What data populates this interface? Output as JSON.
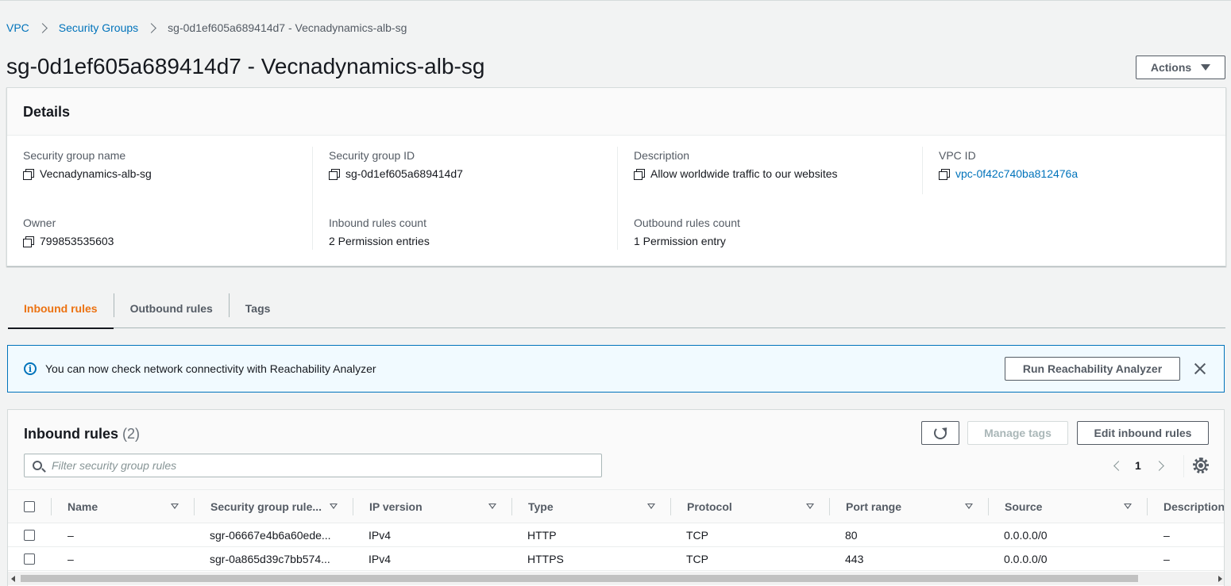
{
  "breadcrumb": {
    "items": [
      "VPC",
      "Security Groups",
      "sg-0d1ef605a689414d7 - Vecnadynamics-alb-sg"
    ]
  },
  "page": {
    "title": "sg-0d1ef605a689414d7 - Vecnadynamics-alb-sg",
    "actions_label": "Actions"
  },
  "details": {
    "heading": "Details",
    "fields": [
      {
        "key": "Security group name",
        "value": "Vecnadynamics-alb-sg"
      },
      {
        "key": "Security group ID",
        "value": "sg-0d1ef605a689414d7"
      },
      {
        "key": "Description",
        "value": "Allow worldwide traffic to our websites"
      },
      {
        "key": "VPC ID",
        "value": "vpc-0f42c740ba812476a"
      },
      {
        "key": "Owner",
        "value": "799853535603"
      },
      {
        "key": "Inbound rules count",
        "value": "2 Permission entries"
      },
      {
        "key": "Outbound rules count",
        "value": "1 Permission entry"
      }
    ]
  },
  "tabs": [
    {
      "label": "Inbound rules",
      "active": true
    },
    {
      "label": "Outbound rules",
      "active": false
    },
    {
      "label": "Tags",
      "active": false
    }
  ],
  "flash": {
    "message": "You can now check network connectivity with Reachability Analyzer",
    "button_label": "Run Reachability Analyzer"
  },
  "rules": {
    "title": "Inbound rules",
    "count": "(2)",
    "manage_tags_label": "Manage tags",
    "edit_label": "Edit inbound rules",
    "filter_placeholder": "Filter security group rules",
    "page": "1",
    "columns": [
      "Name",
      "Security group rule...",
      "IP version",
      "Type",
      "Protocol",
      "Port range",
      "Source",
      "Description"
    ],
    "rows": [
      {
        "name": "–",
        "rule_id": "sgr-06667e4b6a60ede...",
        "ip_version": "IPv4",
        "type": "HTTP",
        "protocol": "TCP",
        "port_range": "80",
        "source": "0.0.0.0/0",
        "description": "–"
      },
      {
        "name": "–",
        "rule_id": "sgr-0a865d39c7bb574...",
        "ip_version": "IPv4",
        "type": "HTTPS",
        "protocol": "TCP",
        "port_range": "443",
        "source": "0.0.0.0/0",
        "description": "–"
      }
    ]
  },
  "colors": {
    "link": "#0073bb",
    "active_tab": "#ec7211",
    "info_bg": "#f1faff"
  }
}
